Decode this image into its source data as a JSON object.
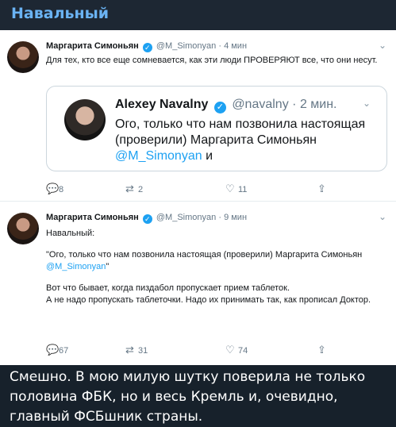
{
  "channel": {
    "title": "Навальный"
  },
  "tweet1": {
    "name": "Маргарита Симоньян",
    "handle": "@M_Simonyan",
    "dot": "·",
    "time": "4 мин",
    "text": "Для тех, кто все еще сомневается, как эти люди ПРОВЕРЯЮТ все, что они несут.",
    "quote": {
      "name": "Alexey Navalny",
      "handle": "@navalny",
      "dot": "·",
      "time": "2 мин.",
      "text_before": "Ого, только что нам позвонила настоящая (проверили) Маргарита Симоньян ",
      "mention": "@M_Simonyan",
      "text_after": " и"
    },
    "replies": "8",
    "retweets": "2",
    "likes": "11"
  },
  "tweet2": {
    "name": "Маргарита Симоньян",
    "handle": "@M_Simonyan",
    "dot": "·",
    "time": "9 мин",
    "line1": "Навальный:",
    "quote_line": "\"Ого, только что нам позвонила настоящая (проверили) Маргарита Симоньян",
    "mention": "@M_Simonyan",
    "quote_close": "\"",
    "line3": "Вот что бывает, когда пиздабол пропускает прием таблеток.",
    "line4": "А не надо пропускать таблеточки. Надо их принимать так, как прописал Доктор.",
    "replies": "67",
    "retweets": "31",
    "likes": "74"
  },
  "caption": "Смешно. В мою милую шутку поверила не только половина ФБК, но и весь Кремль и, очевидно, главный ФСБшник страны."
}
